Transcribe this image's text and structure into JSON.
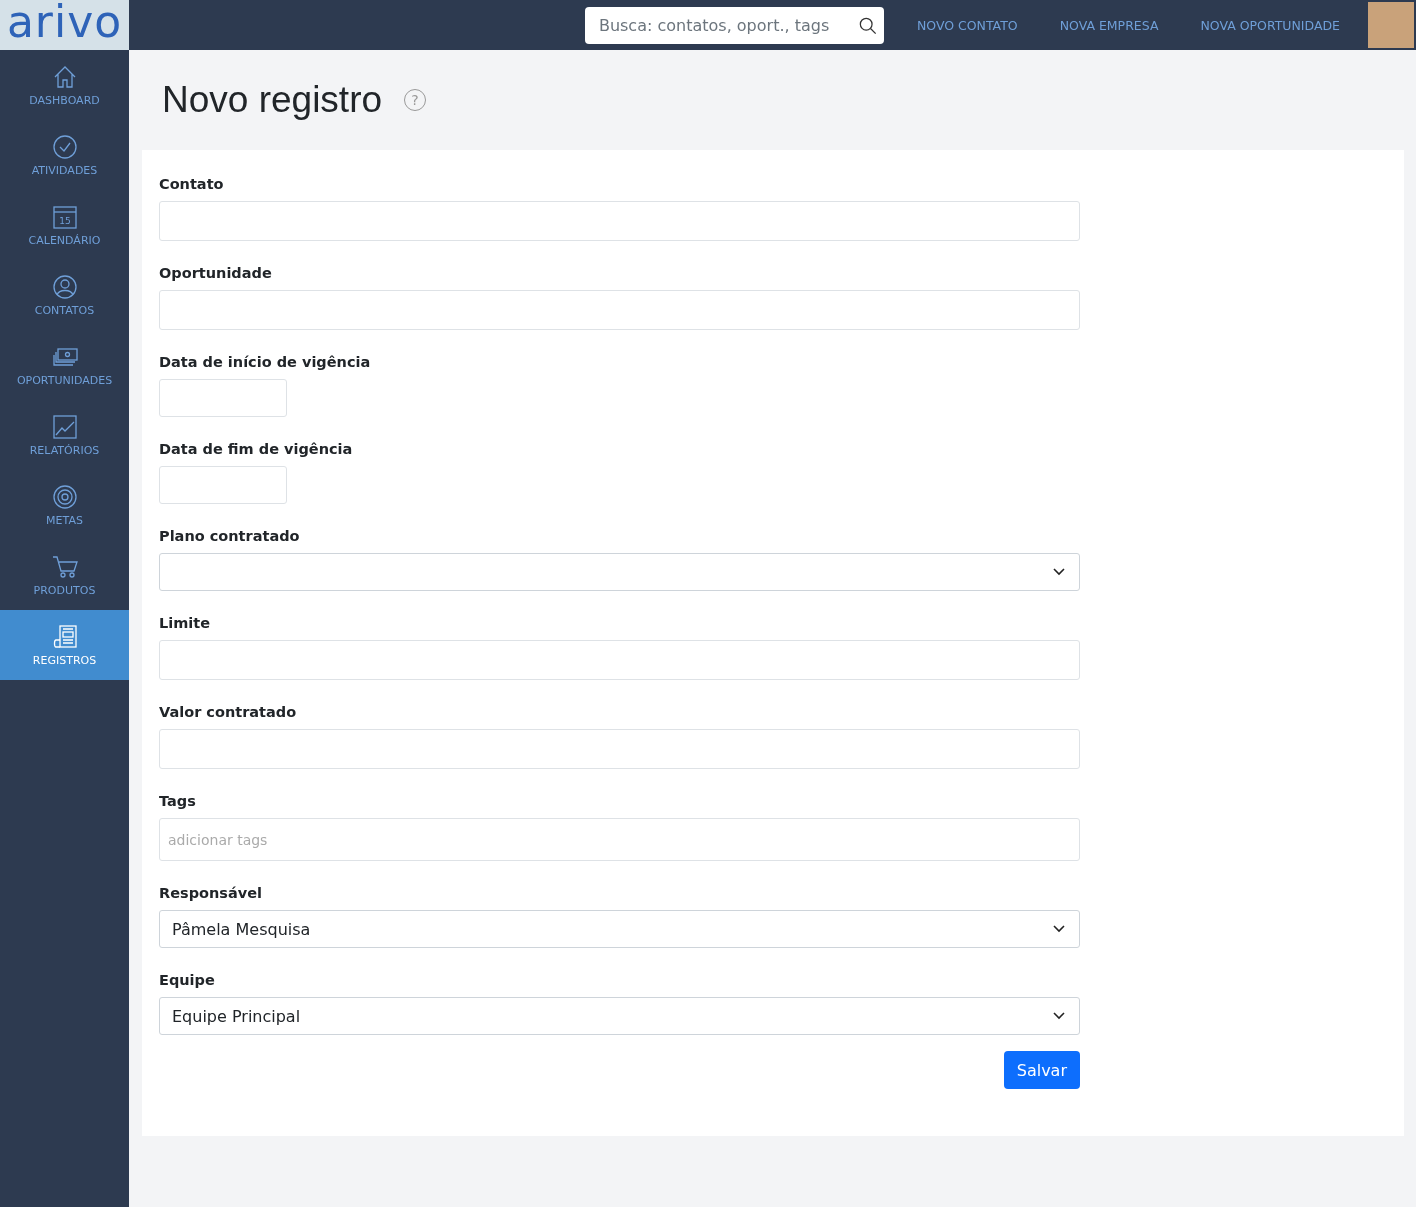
{
  "logo": "arivo",
  "sidebar": {
    "items": [
      {
        "label": "DASHBOARD",
        "selected": false
      },
      {
        "label": "ATIVIDADES",
        "selected": false
      },
      {
        "label": "CALENDÁRIO",
        "selected": false,
        "icon_text": "15"
      },
      {
        "label": "CONTATOS",
        "selected": false
      },
      {
        "label": "OPORTUNIDADES",
        "selected": false
      },
      {
        "label": "RELATÓRIOS",
        "selected": false
      },
      {
        "label": "METAS",
        "selected": false
      },
      {
        "label": "PRODUTOS",
        "selected": false
      },
      {
        "label": "REGISTROS",
        "selected": true
      }
    ]
  },
  "topbar": {
    "search": {
      "placeholder": "Busca: contatos, oport., tags"
    },
    "links": [
      "NOVO CONTATO",
      "NOVA EMPRESA",
      "NOVA OPORTUNIDADE"
    ]
  },
  "page": {
    "title": "Novo registro",
    "help": "?"
  },
  "form": {
    "fields": [
      {
        "label": "Contato",
        "kind": "text"
      },
      {
        "label": "Oportunidade",
        "kind": "text"
      },
      {
        "label": "Data de início de vigência",
        "kind": "date"
      },
      {
        "label": "Data de fim de vigência",
        "kind": "date"
      },
      {
        "label": "Plano contratado",
        "kind": "select"
      },
      {
        "label": "Limite",
        "kind": "text"
      },
      {
        "label": "Valor contratado",
        "kind": "text"
      },
      {
        "label": "Tags",
        "kind": "tags",
        "placeholder": "adicionar tags"
      },
      {
        "label": "Responsável",
        "kind": "select",
        "value": "Pâmela Mesquisa"
      },
      {
        "label": "Equipe",
        "kind": "select",
        "value": "Equipe Principal"
      }
    ],
    "submit": "Salvar"
  }
}
